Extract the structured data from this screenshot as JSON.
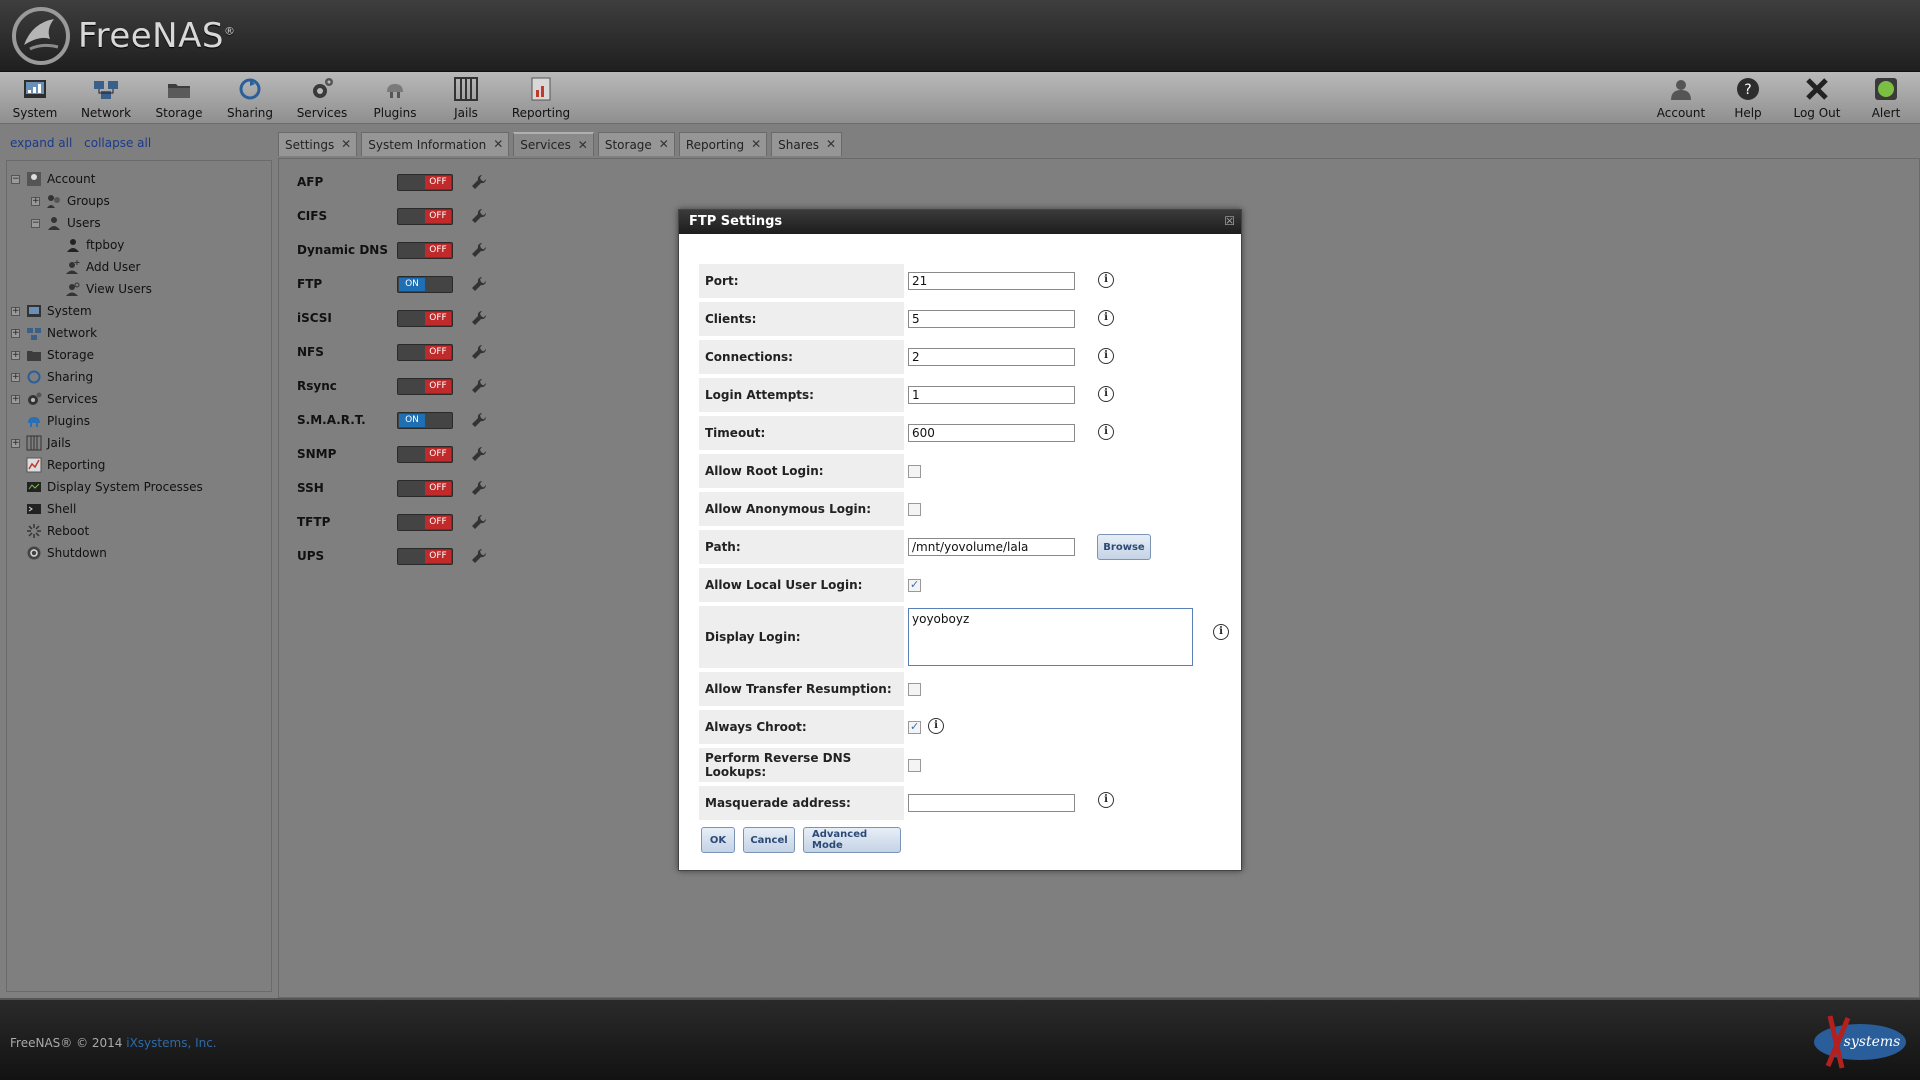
{
  "header": {
    "brand": "FreeNAS",
    "brand_mark": "®"
  },
  "toolbar": {
    "left": [
      {
        "label": "System",
        "icon": "system-icon"
      },
      {
        "label": "Network",
        "icon": "network-icon"
      },
      {
        "label": "Storage",
        "icon": "storage-icon"
      },
      {
        "label": "Sharing",
        "icon": "sharing-icon"
      },
      {
        "label": "Services",
        "icon": "services-icon"
      },
      {
        "label": "Plugins",
        "icon": "plugins-icon"
      },
      {
        "label": "Jails",
        "icon": "jails-icon"
      },
      {
        "label": "Reporting",
        "icon": "reporting-icon"
      }
    ],
    "right": [
      {
        "label": "Account",
        "icon": "account-icon"
      },
      {
        "label": "Help",
        "icon": "help-icon"
      },
      {
        "label": "Log Out",
        "icon": "logout-icon"
      },
      {
        "label": "Alert",
        "icon": "alert-icon"
      }
    ]
  },
  "sidebar": {
    "expand_all": "expand all",
    "collapse_all": "collapse all",
    "items": [
      {
        "label": "Account",
        "exp": "−"
      },
      {
        "label": "Groups",
        "exp": "+"
      },
      {
        "label": "Users",
        "exp": "−"
      },
      {
        "label": "ftpboy",
        "exp": ""
      },
      {
        "label": "Add User",
        "exp": ""
      },
      {
        "label": "View Users",
        "exp": ""
      },
      {
        "label": "System",
        "exp": "+"
      },
      {
        "label": "Network",
        "exp": "+"
      },
      {
        "label": "Storage",
        "exp": "+"
      },
      {
        "label": "Sharing",
        "exp": "+"
      },
      {
        "label": "Services",
        "exp": "+"
      },
      {
        "label": "Plugins",
        "exp": ""
      },
      {
        "label": "Jails",
        "exp": "+"
      },
      {
        "label": "Reporting",
        "exp": ""
      },
      {
        "label": "Display System Processes",
        "exp": ""
      },
      {
        "label": "Shell",
        "exp": ""
      },
      {
        "label": "Reboot",
        "exp": ""
      },
      {
        "label": "Shutdown",
        "exp": ""
      }
    ]
  },
  "tabs": [
    {
      "label": "Settings"
    },
    {
      "label": "System Information"
    },
    {
      "label": "Services"
    },
    {
      "label": "Storage"
    },
    {
      "label": "Reporting"
    },
    {
      "label": "Shares"
    }
  ],
  "active_tab": "Services",
  "services": [
    {
      "name": "AFP",
      "state": "OFF"
    },
    {
      "name": "CIFS",
      "state": "OFF"
    },
    {
      "name": "Dynamic DNS",
      "state": "OFF"
    },
    {
      "name": "FTP",
      "state": "ON"
    },
    {
      "name": "iSCSI",
      "state": "OFF"
    },
    {
      "name": "NFS",
      "state": "OFF"
    },
    {
      "name": "Rsync",
      "state": "OFF"
    },
    {
      "name": "S.M.A.R.T.",
      "state": "ON"
    },
    {
      "name": "SNMP",
      "state": "OFF"
    },
    {
      "name": "SSH",
      "state": "OFF"
    },
    {
      "name": "TFTP",
      "state": "OFF"
    },
    {
      "name": "UPS",
      "state": "OFF"
    }
  ],
  "dialog": {
    "title": "FTP Settings",
    "close": "☒",
    "fields": {
      "port": {
        "label": "Port:",
        "value": "21"
      },
      "clients": {
        "label": "Clients:",
        "value": "5"
      },
      "connections": {
        "label": "Connections:",
        "value": "2"
      },
      "login_attempts": {
        "label": "Login Attempts:",
        "value": "1"
      },
      "timeout": {
        "label": "Timeout:",
        "value": "600"
      },
      "allow_root_login": {
        "label": "Allow Root Login:",
        "checked": false
      },
      "allow_anonymous_login": {
        "label": "Allow Anonymous Login:",
        "checked": false
      },
      "path": {
        "label": "Path:",
        "value": "/mnt/yovolume/lala",
        "browse": "Browse"
      },
      "allow_local_user_login": {
        "label": "Allow Local User Login:",
        "checked": true
      },
      "display_login": {
        "label": "Display Login:",
        "value": "yoyoboyz"
      },
      "allow_transfer_resumption": {
        "label": "Allow Transfer Resumption:",
        "checked": false
      },
      "always_chroot": {
        "label": "Always Chroot:",
        "checked": true
      },
      "reverse_dns": {
        "label": "Perform Reverse DNS Lookups:",
        "checked": false
      },
      "masquerade": {
        "label": "Masquerade address:",
        "value": ""
      }
    },
    "buttons": {
      "ok": "OK",
      "cancel": "Cancel",
      "advanced": "Advanced Mode"
    }
  },
  "footer": {
    "text": "FreeNAS® © 2014 ",
    "link": "iXsystems, Inc.",
    "logo_text": "systems"
  },
  "colors": {
    "off": "#c12a2a",
    "on": "#1e6fb3",
    "link": "#1a3a8c"
  }
}
